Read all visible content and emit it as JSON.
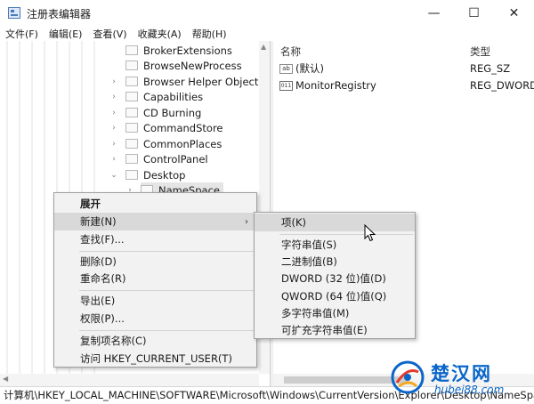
{
  "window": {
    "title": "注册表编辑器",
    "min_glyph": "—",
    "max_glyph": "☐",
    "close_glyph": "✕"
  },
  "menubar": [
    "文件(F)",
    "编辑(E)",
    "查看(V)",
    "收藏夹(A)",
    "帮助(H)"
  ],
  "tree": {
    "items": [
      {
        "label": "BrokerExtensions",
        "expander": ""
      },
      {
        "label": "BrowseNewProcess",
        "expander": ""
      },
      {
        "label": "Browser Helper Objects",
        "expander": "›"
      },
      {
        "label": "Capabilities",
        "expander": "›"
      },
      {
        "label": "CD Burning",
        "expander": "›"
      },
      {
        "label": "CommandStore",
        "expander": "›"
      },
      {
        "label": "CommonPlaces",
        "expander": "›"
      },
      {
        "label": "ControlPanel",
        "expander": "›"
      },
      {
        "label": "Desktop",
        "expander": "⌄"
      },
      {
        "label": "NameSpace",
        "expander": "›"
      }
    ]
  },
  "values": {
    "columns": {
      "name": "名称",
      "type": "类型"
    },
    "rows": [
      {
        "icon": "ab",
        "name": "(默认)",
        "type": "REG_SZ"
      },
      {
        "icon": "011",
        "name": "MonitorRegistry",
        "type": "REG_DWORD"
      }
    ]
  },
  "context_menu": {
    "items": [
      "展开",
      "新建(N)",
      "查找(F)...",
      "删除(D)",
      "重命名(R)",
      "导出(E)",
      "权限(P)...",
      "复制项名称(C)",
      "访问 HKEY_CURRENT_USER(T)"
    ],
    "submenu_arrow": "›"
  },
  "submenu": {
    "items": [
      "项(K)",
      "字符串值(S)",
      "二进制值(B)",
      "DWORD (32 位)值(D)",
      "QWORD (64 位)值(Q)",
      "多字符串值(M)",
      "可扩充字符串值(E)"
    ]
  },
  "statusbar": {
    "path": "计算机\\HKEY_LOCAL_MACHINE\\SOFTWARE\\Microsoft\\Windows\\CurrentVersion\\Explorer\\Desktop\\NameSpace"
  },
  "watermark": {
    "title": "楚汉网",
    "url": "hubei88.com"
  },
  "colors": {
    "menu_highlight": "#d9d9d9",
    "watermark_blue": "#0a66c9"
  }
}
